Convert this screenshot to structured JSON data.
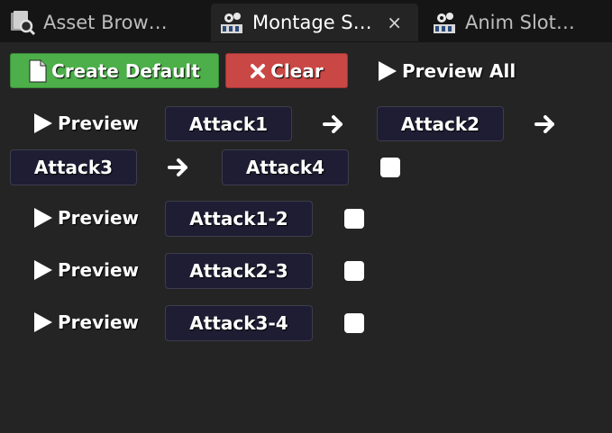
{
  "tabs": [
    {
      "label": "Asset Brow…",
      "icon": "asset-browser-icon",
      "active": false
    },
    {
      "label": "Montage S…",
      "icon": "montage-icon",
      "active": true,
      "close": "×"
    },
    {
      "label": "Anim Slot…",
      "icon": "anim-slot-icon",
      "active": false
    }
  ],
  "toolbar": {
    "create_default": "Create Default",
    "clear": "Clear",
    "preview_all": "Preview All"
  },
  "preview_label": "Preview",
  "sections": [
    {
      "slots": [
        "Attack1",
        "Attack2",
        "Attack3",
        "Attack4"
      ],
      "checked": false
    },
    {
      "slots": [
        "Attack1-2"
      ],
      "checked": false
    },
    {
      "slots": [
        "Attack2-3"
      ],
      "checked": false
    },
    {
      "slots": [
        "Attack3-4"
      ],
      "checked": false
    }
  ],
  "colors": {
    "background": "#242424",
    "tabbar": "#151515",
    "create_button": "#4caf49",
    "clear_button": "#c94745",
    "slot_background": "#1e1d33"
  }
}
